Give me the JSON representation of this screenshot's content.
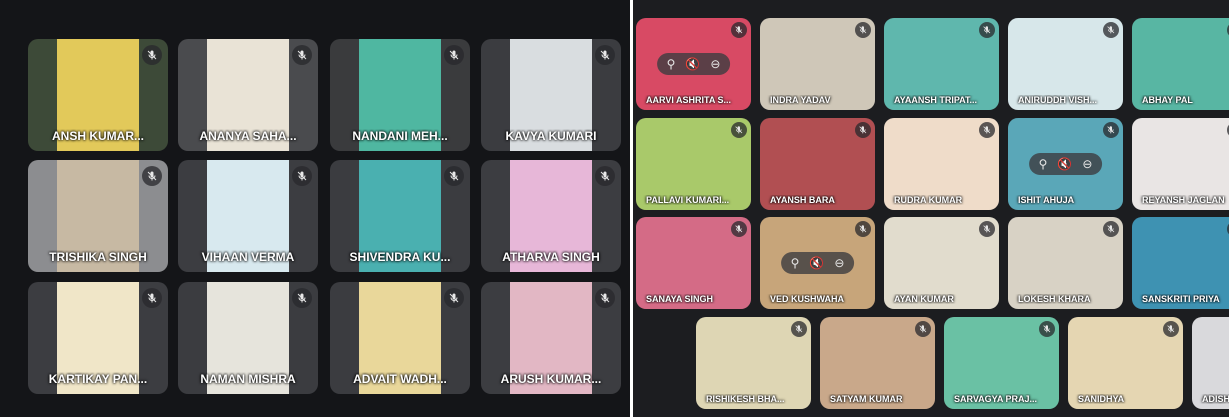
{
  "left_grid": {
    "participants": [
      {
        "name": "ANSH KUMAR...",
        "bg": "#3d4a38",
        "video": "#e2c95a"
      },
      {
        "name": "ANANYA SAHA...",
        "bg": "#4a4b4e",
        "video": "#e9e3d6"
      },
      {
        "name": "NANDANI MEH...",
        "bg": "#3a3b3d",
        "video": "#4fb7a1"
      },
      {
        "name": "KAVYA KUMARI",
        "bg": "#3b3c40",
        "video": "#d9dde0"
      },
      {
        "name": "TRISHIKA SINGH",
        "bg": "#8c8d90",
        "video": "#c7b9a3"
      },
      {
        "name": "VIHAAN VERMA",
        "bg": "#3c3d41",
        "video": "#d8e9ef"
      },
      {
        "name": "SHIVENDRA KU...",
        "bg": "#3b3c40",
        "video": "#4ab0b0"
      },
      {
        "name": "ATHARVA SINGH",
        "bg": "#3c3d41",
        "video": "#e7b7d8"
      },
      {
        "name": "KARTIKAY PAN...",
        "bg": "#3c3d41",
        "video": "#f0e6c8"
      },
      {
        "name": "NAMAN MISHRA",
        "bg": "#3b3c40",
        "video": "#e6e4dc"
      },
      {
        "name": "ADVAIT WADH...",
        "bg": "#3b3c40",
        "video": "#e9d79a"
      },
      {
        "name": "ARUSH KUMAR...",
        "bg": "#3c3d41",
        "video": "#e2b7c4"
      }
    ]
  },
  "right_grid": {
    "rows": [
      [
        {
          "name": "AARVI ASHRITA S...",
          "video": "#d84a64",
          "pinned": true
        },
        {
          "name": "INDRA YADAV",
          "video": "#cfc7b8",
          "pinned": false
        },
        {
          "name": "AYAANSH TRIPAT...",
          "video": "#5fb7ad",
          "pinned": false
        },
        {
          "name": "ANIRUDDH VISH...",
          "video": "#d7e7ea",
          "pinned": false
        },
        {
          "name": "ABHAY PAL",
          "video": "#58b6a3",
          "pinned": false
        }
      ],
      [
        {
          "name": "PALLAVI KUMARI...",
          "video": "#a9c96a",
          "pinned": false
        },
        {
          "name": "AYANSH BARA",
          "video": "#b14f52",
          "pinned": false
        },
        {
          "name": "RUDRA KUMAR",
          "video": "#efdcc9",
          "pinned": false
        },
        {
          "name": "ISHIT AHUJA",
          "video": "#5aa7b8",
          "pinned": true
        },
        {
          "name": "REYANSH JAGLAN",
          "video": "#e9e5e4",
          "pinned": false
        }
      ],
      [
        {
          "name": "SANAYA SINGH",
          "video": "#d46b86",
          "pinned": false
        },
        {
          "name": "VED KUSHWAHA",
          "video": "#c7a57a",
          "pinned": true
        },
        {
          "name": "AYAN KUMAR",
          "video": "#e1dccd",
          "pinned": false
        },
        {
          "name": "LOKESH KHARA",
          "video": "#d8d2c5",
          "pinned": false
        },
        {
          "name": "SANSKRITI PRIYA",
          "video": "#3e92b2",
          "pinned": false
        }
      ],
      [
        {
          "name": "RISHIKESH BHA...",
          "video": "#ded6b4",
          "pinned": false
        },
        {
          "name": "SATYAM KUMAR",
          "video": "#c9a88a",
          "pinned": false
        },
        {
          "name": "SARVAGYA PRAJ...",
          "video": "#6ac1a4",
          "pinned": false
        },
        {
          "name": "SANIDHYA",
          "video": "#e5d6b2",
          "pinned": false
        },
        {
          "name": "ADISH",
          "video": "#d9d9dc",
          "pinned": false
        }
      ]
    ],
    "pin_controls": {
      "pin": "⚲",
      "mute": "🔇",
      "remove": "⊖"
    }
  }
}
